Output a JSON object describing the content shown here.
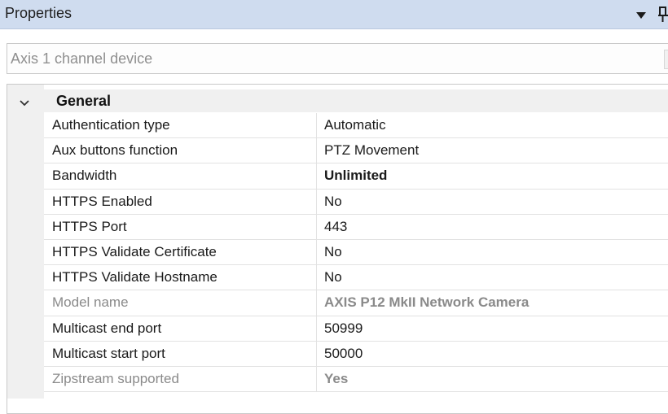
{
  "panel": {
    "title": "Properties",
    "dropdown_icon": "triangle-down-icon",
    "pin_icon": "pin-icon"
  },
  "object_selector": {
    "value": "Axis 1 channel device",
    "button_icon": "chevron-down-icon"
  },
  "grid": {
    "category": {
      "label": "General",
      "expanded": true,
      "icon": "chevron-down-icon"
    },
    "rows": [
      {
        "name": "Authentication type",
        "value": "Automatic",
        "bold": false,
        "readonly": false
      },
      {
        "name": "Aux buttons function",
        "value": "PTZ Movement",
        "bold": false,
        "readonly": false
      },
      {
        "name": "Bandwidth",
        "value": "Unlimited",
        "bold": true,
        "readonly": false
      },
      {
        "name": "HTTPS Enabled",
        "value": "No",
        "bold": false,
        "readonly": false
      },
      {
        "name": "HTTPS Port",
        "value": "443",
        "bold": false,
        "readonly": false
      },
      {
        "name": "HTTPS Validate Certificate",
        "value": "No",
        "bold": false,
        "readonly": false
      },
      {
        "name": "HTTPS Validate Hostname",
        "value": "No",
        "bold": false,
        "readonly": false
      },
      {
        "name": "Model name",
        "value": "AXIS P12 MkII Network Camera",
        "bold": true,
        "readonly": true
      },
      {
        "name": "Multicast end port",
        "value": "50999",
        "bold": false,
        "readonly": false
      },
      {
        "name": "Multicast start port",
        "value": "50000",
        "bold": false,
        "readonly": false
      },
      {
        "name": "Zipstream supported",
        "value": "Yes",
        "bold": true,
        "readonly": true
      }
    ]
  }
}
